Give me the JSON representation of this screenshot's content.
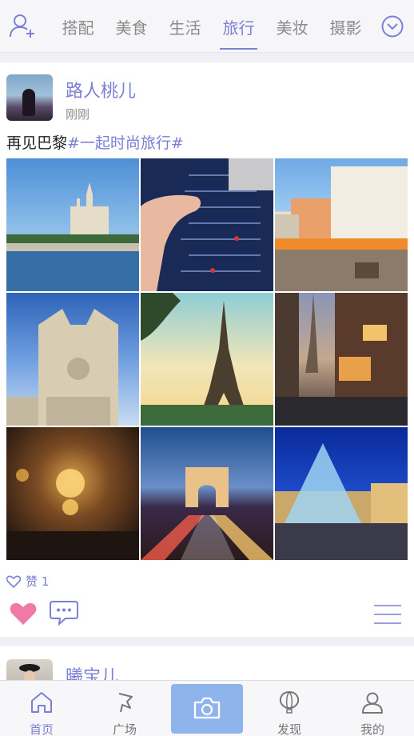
{
  "topbar": {
    "tabs": [
      {
        "label": "搭配"
      },
      {
        "label": "美食"
      },
      {
        "label": "生活"
      },
      {
        "label": "旅行"
      },
      {
        "label": "美妆"
      },
      {
        "label": "摄影"
      }
    ],
    "active_tab": "旅行"
  },
  "post": {
    "username": "路人桃儿",
    "time": "刚刚",
    "text_plain": "再见巴黎",
    "text_tag": "#一起时尚旅行#",
    "likes_label": "赞 1",
    "photos": [
      "notre-dame-river",
      "love-wall-hand",
      "riverside-cafe-street",
      "notre-dame-facade",
      "eiffel-tower-sunset",
      "eiffel-street-night",
      "grand-hall-chandelier",
      "arc-de-triomphe-night",
      "louvre-pyramid-night"
    ]
  },
  "next_post": {
    "username": "曦宝儿"
  },
  "bottom_nav": {
    "items": [
      {
        "label": "首页"
      },
      {
        "label": "广场"
      },
      {
        "label": "发现"
      },
      {
        "label": "我的"
      }
    ]
  },
  "colors": {
    "accent": "#7b7fd6",
    "heart": "#f07aa6",
    "camera_bg": "#8fb4ec"
  }
}
